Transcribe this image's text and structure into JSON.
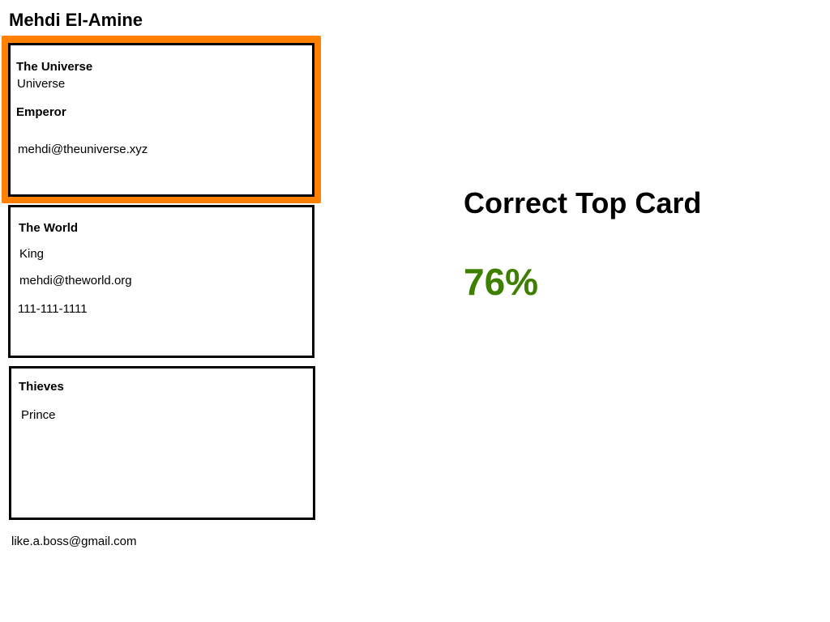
{
  "header": {
    "name": "Mehdi El-Amine"
  },
  "cards": [
    {
      "company": "The Universe",
      "subtitle": "Universe",
      "title": "Emperor",
      "email": "mehdi@theuniverse.xyz",
      "selected": true
    },
    {
      "company": "The World",
      "title": "King",
      "email": "mehdi@theworld.org",
      "phone": "111-111-1111",
      "selected": false
    },
    {
      "company": "Thieves",
      "title": "Prince",
      "selected": false
    }
  ],
  "footer": {
    "email": "like.a.boss@gmail.com"
  },
  "result": {
    "label": "Correct Top Card",
    "value": "76%"
  },
  "colors": {
    "highlight": "#ff8000",
    "result_value": "#3f7f00",
    "card_border": "#000000"
  }
}
